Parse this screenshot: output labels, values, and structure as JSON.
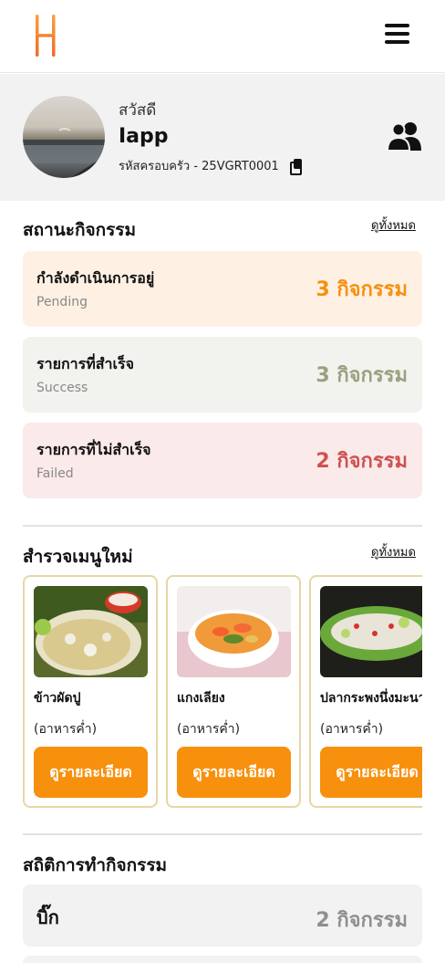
{
  "header": {
    "logo_icon": "h-logo-icon",
    "menu_icon": "hamburger-icon"
  },
  "profile": {
    "greeting": "สวัสดี",
    "name": "Iapp",
    "family_code": "รหัสครอบครัว - 25VGRT0001",
    "copy_icon": "copy-icon",
    "group_icon": "family-group-icon"
  },
  "activity_status": {
    "title": "สถานะกิจกรรม",
    "see_all": "ดูทั้งหมด",
    "items": [
      {
        "label": "กำลังดำเนินการอยู่",
        "sub": "Pending",
        "count": "3 กิจกรรม",
        "bg": "#fef1e4",
        "color": "#f7900d"
      },
      {
        "label": "รายการที่สำเร็จ",
        "sub": "Success",
        "count": "3 กิจกรรม",
        "bg": "#f2f2ee",
        "color": "#9aa07f"
      },
      {
        "label": "รายการที่ไม่สำเร็จ",
        "sub": "Failed",
        "count": "2 กิจกรรม",
        "bg": "#fbeaea",
        "color": "#d05050"
      }
    ]
  },
  "menu_survey": {
    "title": "สำรวจเมนูใหม่",
    "see_all": "ดูทั้งหมด",
    "items": [
      {
        "name": "ข้าวผัดปู",
        "meal": "(อาหารค่ำ)",
        "button": "ดูรายละเอียด"
      },
      {
        "name": "แกงเลียง",
        "meal": "(อาหารค่ำ)",
        "button": "ดูรายละเอียด"
      },
      {
        "name": "ปลากระพงนึ่งมะนาว",
        "meal": "(อาหารค่ำ)",
        "button": "ดูรายละเอียด"
      }
    ]
  },
  "activity_stats": {
    "title": "สถิติการทำกิจกรรม",
    "items": [
      {
        "label": "บิ๊ก",
        "count": "2 กิจกรรม"
      }
    ]
  },
  "colors": {
    "accent": "#f7900d",
    "card_border": "#e7d6a6"
  }
}
